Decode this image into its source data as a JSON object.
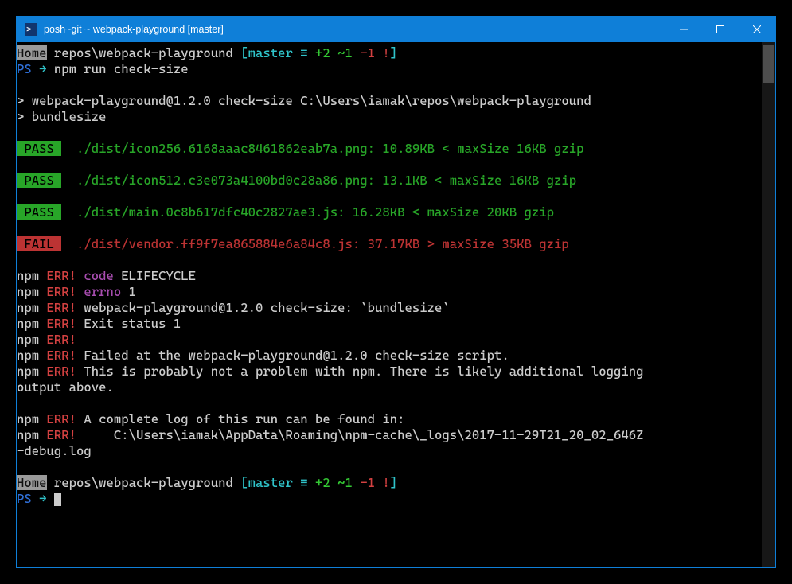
{
  "window": {
    "title": "posh~git ~ webpack-playground [master]"
  },
  "prompt1": {
    "home_badge": "Home",
    "path": " repos\\webpack-playground ",
    "bracket_open": "[",
    "branch": "master",
    "status_equiv": " ≡ ",
    "status_plus": "+2 ",
    "status_tilde": "~1 ",
    "status_minus": "-1 ",
    "status_bang": "!",
    "bracket_close": "]",
    "ps": "PS ",
    "arrow": "→",
    "cmd": " npm run check-size"
  },
  "npm_header": {
    "line1": "> webpack-playground@1.2.0 check-size C:\\Users\\iamak\\repos\\webpack-playground",
    "line2": "> bundlesize"
  },
  "results": [
    {
      "badge": " PASS ",
      "pass": true,
      "text": "  ./dist/icon256.6168aaac8461862eab7a.png: 10.89KB < maxSize 16KB gzip"
    },
    {
      "badge": " PASS ",
      "pass": true,
      "text": "  ./dist/icon512.c3e073a4100bd0c28a86.png: 13.1KB < maxSize 16KB gzip"
    },
    {
      "badge": " PASS ",
      "pass": true,
      "text": "  ./dist/main.0c8b617dfc40c2827ae3.js: 16.28KB < maxSize 20KB gzip"
    },
    {
      "badge": " FAIL ",
      "pass": false,
      "text": "  ./dist/vendor.ff9f7ea865884e6a84c8.js: 37.17KB > maxSize 35KB gzip"
    }
  ],
  "err": {
    "npm": "npm ",
    "err": "ERR!",
    "code_k": " code ",
    "code_v": "ELIFECYCLE",
    "errno_k": " errno ",
    "errno_v": "1",
    "l3": " webpack-playground@1.2.0 check-size: `bundlesize`",
    "l4": " Exit status 1",
    "l6": " Failed at the webpack-playground@1.2.0 check-size script.",
    "l7a": " This is probably not a problem with npm. There is likely additional logging ",
    "l7b": "output above.",
    "l9": " A complete log of this run can be found in:",
    "l10a": "     C:\\Users\\iamak\\AppData\\Roaming\\npm-cache\\_logs\\2017-11-29T21_20_02_646Z",
    "l10b": "-debug.log"
  },
  "prompt2": {
    "home_badge": "Home",
    "path": " repos\\webpack-playground ",
    "bracket_open": "[",
    "branch": "master",
    "status_equiv": " ≡ ",
    "status_plus": "+2 ",
    "status_tilde": "~1 ",
    "status_minus": "-1 ",
    "status_bang": "!",
    "bracket_close": "]",
    "ps": "PS ",
    "arrow": "→ "
  }
}
